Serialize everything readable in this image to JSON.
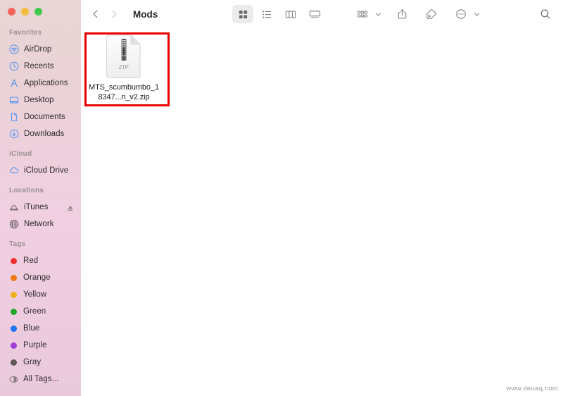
{
  "window": {
    "title": "Mods",
    "traffic_lights": [
      {
        "name": "close",
        "color": "#f4625c"
      },
      {
        "name": "minimize",
        "color": "#f5bd3f"
      },
      {
        "name": "maximize",
        "color": "#40c94b"
      }
    ]
  },
  "toolbar": {
    "back_label": "‹",
    "forward_label": "›",
    "view_buttons": [
      {
        "name": "icon-view",
        "icon": "grid-icon",
        "selected": true
      },
      {
        "name": "list-view",
        "icon": "list-icon",
        "selected": false
      },
      {
        "name": "column-view",
        "icon": "columns-icon",
        "selected": false
      },
      {
        "name": "gallery-view",
        "icon": "gallery-icon",
        "selected": false
      }
    ],
    "action_buttons": [
      {
        "name": "group-by",
        "icon": "group-grid-icon",
        "has_chevron": true
      },
      {
        "name": "share",
        "icon": "share-icon",
        "has_chevron": false
      },
      {
        "name": "tags",
        "icon": "tag-icon",
        "has_chevron": false
      },
      {
        "name": "more-actions",
        "icon": "ellipsis-circle-icon",
        "has_chevron": true
      }
    ],
    "search": {
      "name": "search",
      "icon": "search-icon"
    }
  },
  "sidebar": {
    "sections": [
      {
        "title": "Favorites",
        "items": [
          {
            "label": "AirDrop",
            "icon": "airdrop-icon"
          },
          {
            "label": "Recents",
            "icon": "clock-icon"
          },
          {
            "label": "Applications",
            "icon": "applications-icon"
          },
          {
            "label": "Desktop",
            "icon": "desktop-icon"
          },
          {
            "label": "Documents",
            "icon": "document-icon"
          },
          {
            "label": "Downloads",
            "icon": "download-icon"
          }
        ]
      },
      {
        "title": "iCloud",
        "items": [
          {
            "label": "iCloud Drive",
            "icon": "cloud-icon"
          }
        ]
      },
      {
        "title": "Locations",
        "items": [
          {
            "label": "iTunes",
            "icon": "disk-icon",
            "eject": true
          },
          {
            "label": "Network",
            "icon": "network-icon",
            "eject": false
          }
        ]
      },
      {
        "title": "Tags",
        "items": [
          {
            "label": "Red",
            "icon": "tag-dot",
            "color": "#f43030"
          },
          {
            "label": "Orange",
            "icon": "tag-dot",
            "color": "#ef7b12"
          },
          {
            "label": "Yellow",
            "icon": "tag-dot",
            "color": "#eeb11c"
          },
          {
            "label": "Green",
            "icon": "tag-dot",
            "color": "#1fa82e"
          },
          {
            "label": "Blue",
            "icon": "tag-dot",
            "color": "#1a72ec"
          },
          {
            "label": "Purple",
            "icon": "tag-dot",
            "color": "#a23fd8"
          },
          {
            "label": "Gray",
            "icon": "tag-dot",
            "color": "#5d5556"
          },
          {
            "label": "All Tags...",
            "icon": "all-tags-icon",
            "color": ""
          }
        ]
      }
    ]
  },
  "content": {
    "files": [
      {
        "name_line_1": "MTS_scumbumbo",
        "name_line_2": "_18347...n_v2.zip",
        "full_name": "MTS_scumbumbo_18347...n_v2.zip",
        "icon": "zip-file-icon",
        "icon_badge": "ZIP",
        "highlighted": true
      }
    ]
  },
  "annotation": {
    "highlight_color": "#e70000"
  },
  "watermark": {
    "text": "www.deuaq.com"
  }
}
